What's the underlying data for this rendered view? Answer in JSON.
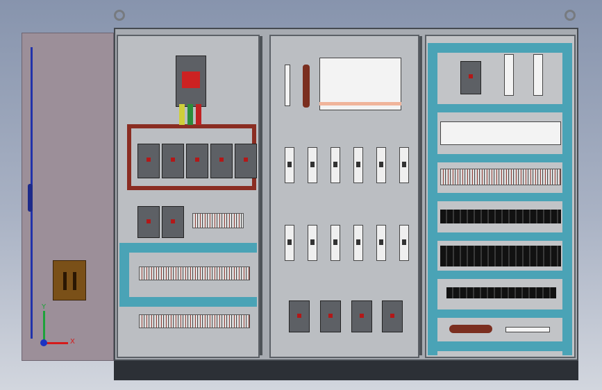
{
  "axes": {
    "x_label": "X",
    "y_label": "Y"
  },
  "colors": {
    "door": "#9c8f99",
    "enclosure": "#a7abb1",
    "busbar": "#8a2d22",
    "din_rail": "#4aa3b6",
    "breaker_label": "#b31818",
    "axis_x": "#d51a1a",
    "axis_y": "#1ea23a",
    "axis_z": "#1b33c2"
  },
  "counts": {
    "section1_breakers_top_row": 5,
    "section1_breakers_bottom_row": 2,
    "section2_fuse_holders_per_row": 6,
    "section2_small_breakers": 4
  }
}
